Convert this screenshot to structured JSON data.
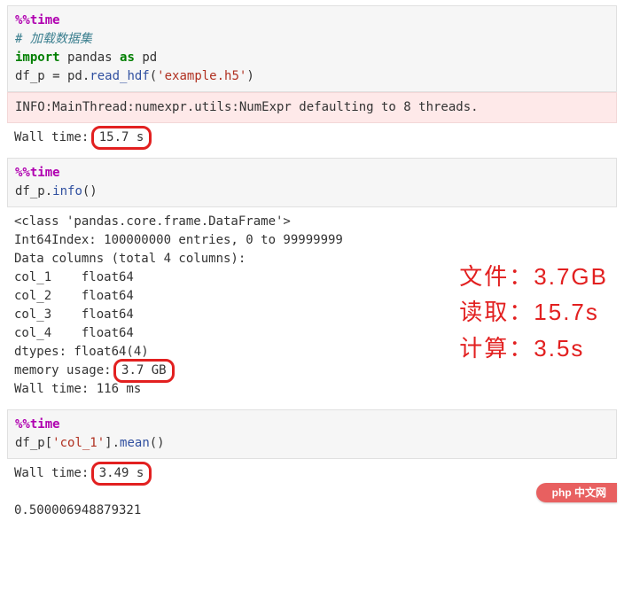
{
  "cell1": {
    "magic": "%%time",
    "comment": "# 加载数据集",
    "import_kw": "import",
    "import_mod": "pandas",
    "import_as": "as",
    "import_alias": "pd",
    "assign": "df_p = pd.",
    "method": "read_hdf",
    "arg_str": "'example.h5'"
  },
  "out1": {
    "stderr": "INFO:MainThread:numexpr.utils:NumExpr defaulting to 8 threads.",
    "wall_label": "Wall time: ",
    "wall_value": "15.7 s"
  },
  "cell2": {
    "magic": "%%time",
    "call_obj": "df_p.",
    "call_method": "info",
    "call_suffix": "()"
  },
  "out2": {
    "class": "<class 'pandas.core.frame.DataFrame'>",
    "index": "Int64Index: 100000000 entries, 0 to 99999999",
    "cols_header": "Data columns (total 4 columns):",
    "cols": [
      "col_1    float64",
      "col_2    float64",
      "col_3    float64",
      "col_4    float64"
    ],
    "dtypes": "dtypes: float64(4)",
    "mem_label": "memory usage: ",
    "mem_value": "3.7 GB",
    "wall": "Wall time: 116 ms"
  },
  "overlay": {
    "file": "文件：3.7GB",
    "read": "读取：15.7s",
    "calc": "计算：3.5s"
  },
  "cell3": {
    "magic": "%%time",
    "expr_pre": "df_p[",
    "expr_str": "'col_1'",
    "expr_post": "].",
    "expr_method": "mean",
    "expr_suffix": "()"
  },
  "out3": {
    "wall_label": "Wall time: ",
    "wall_value": "3.49 s",
    "result": "0.500006948879321"
  },
  "watermark": "php 中文网"
}
